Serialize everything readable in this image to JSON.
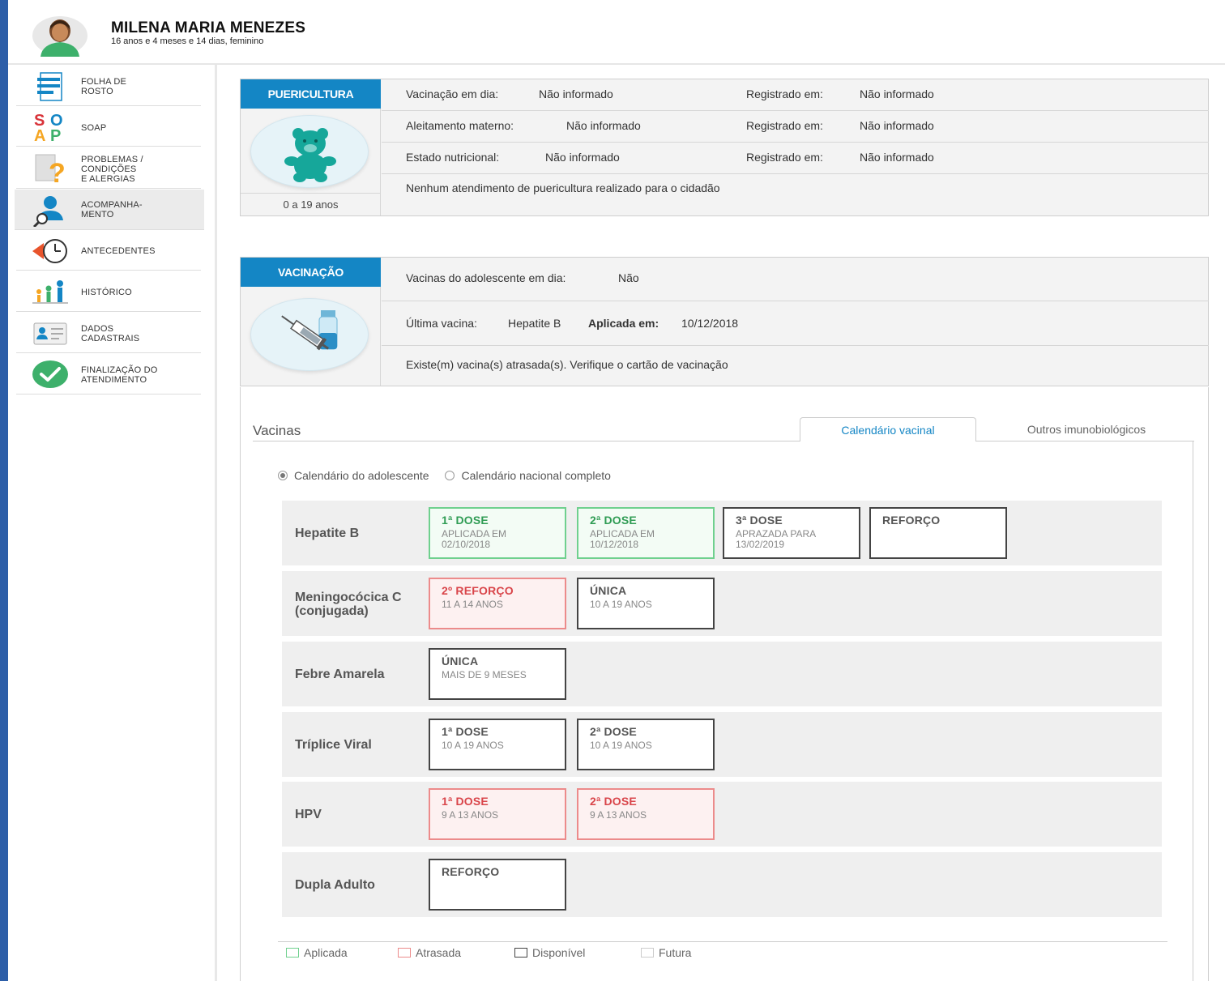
{
  "patient": {
    "name": "MILENA MARIA MENEZES",
    "info": "16 anos e 4 meses e 14 dias, feminino"
  },
  "sidebar": {
    "items": [
      {
        "label": "FOLHA DE ROSTO",
        "icon": "document-lines-icon"
      },
      {
        "label": "SOAP",
        "icon": "soap-letters-icon"
      },
      {
        "label": "PROBLEMAS / CONDIÇÕES E ALERGIAS",
        "icon": "question-document-icon"
      },
      {
        "label": "ACOMPANHA-MENTO",
        "icon": "person-search-icon"
      },
      {
        "label": "ANTECEDENTES",
        "icon": "clock-back-icon"
      },
      {
        "label": "HISTÓRICO",
        "icon": "family-history-icon"
      },
      {
        "label": "DADOS CADASTRAIS",
        "icon": "id-card-icon"
      },
      {
        "label": "FINALIZAÇÃO DO ATENDIMENTO",
        "icon": "check-circle-icon"
      }
    ]
  },
  "puericultura": {
    "tag": "PUERICULTURA",
    "age_range": "0 a 19 anos",
    "rows": [
      {
        "label": "Vacinação em dia:",
        "value": "Não informado",
        "reg_label": "Registrado em:",
        "reg_value": "Não informado"
      },
      {
        "label": "Aleitamento materno:",
        "value": "Não informado",
        "reg_label": "Registrado em:",
        "reg_value": "Não informado"
      },
      {
        "label": "Estado nutricional:",
        "value": "Não informado",
        "reg_label": "Registrado em:",
        "reg_value": "Não informado"
      }
    ],
    "note": "Nenhum atendimento de puericultura realizado para o cidadão"
  },
  "vacinacao": {
    "tag": "VACINAÇÃO",
    "row1": {
      "label": "Vacinas do adolescente em dia:",
      "value": "Não"
    },
    "row2": {
      "label": "Última vacina:",
      "value": "Hepatite B",
      "applied_label": "Aplicada em:",
      "applied_value": "10/12/2018"
    },
    "row3": "Existe(m) vacina(s) atrasada(s). Verifique o cartão de vacinação"
  },
  "vacinas": {
    "title": "Vacinas",
    "tabs": [
      "Calendário vacinal",
      "Outros imunobiológicos"
    ],
    "radio": [
      "Calendário do adolescente",
      "Calendário nacional completo"
    ],
    "rows": [
      {
        "name": "Hepatite B",
        "doses": [
          {
            "label": "1ª DOSE",
            "sub": "APLICADA EM 02/10/2018",
            "status": "green"
          },
          {
            "label": "2ª DOSE",
            "sub": "APLICADA EM 10/12/2018",
            "status": "green"
          },
          {
            "label": "3ª DOSE",
            "sub": "APRAZADA PARA 13/02/2019",
            "status": "black"
          },
          {
            "label": "REFORÇO",
            "sub": "",
            "status": "black"
          }
        ]
      },
      {
        "name": "Meningocócica C (conjugada)",
        "doses": [
          {
            "label": "2º REFORÇO",
            "sub": "11 A 14 ANOS",
            "status": "red"
          },
          {
            "label": "ÚNICA",
            "sub": "10 A 19 ANOS",
            "status": "black"
          }
        ]
      },
      {
        "name": "Febre Amarela",
        "doses": [
          {
            "label": "ÚNICA",
            "sub": "MAIS DE 9 MESES",
            "status": "black"
          }
        ]
      },
      {
        "name": "Tríplice Viral",
        "doses": [
          {
            "label": "1ª DOSE",
            "sub": "10 A 19 ANOS",
            "status": "black"
          },
          {
            "label": "2ª DOSE",
            "sub": "10 A 19 ANOS",
            "status": "black"
          }
        ]
      },
      {
        "name": "HPV",
        "doses": [
          {
            "label": "1ª DOSE",
            "sub": "9 A 13 ANOS",
            "status": "red"
          },
          {
            "label": "2ª DOSE",
            "sub": "9 A 13 ANOS",
            "status": "red"
          }
        ]
      },
      {
        "name": "Dupla Adulto",
        "doses": [
          {
            "label": "REFORÇO",
            "sub": "",
            "status": "black"
          }
        ]
      }
    ],
    "legend": [
      {
        "label": "Aplicada",
        "color": "#6fd08e"
      },
      {
        "label": "Atrasada",
        "color": "#ec8b8b"
      },
      {
        "label": "Disponível",
        "color": "#444444"
      },
      {
        "label": "Futura",
        "color": "#cccccc"
      }
    ]
  },
  "colors": {
    "accent": "#1486c5",
    "left_bar": "#2d5ea8"
  }
}
